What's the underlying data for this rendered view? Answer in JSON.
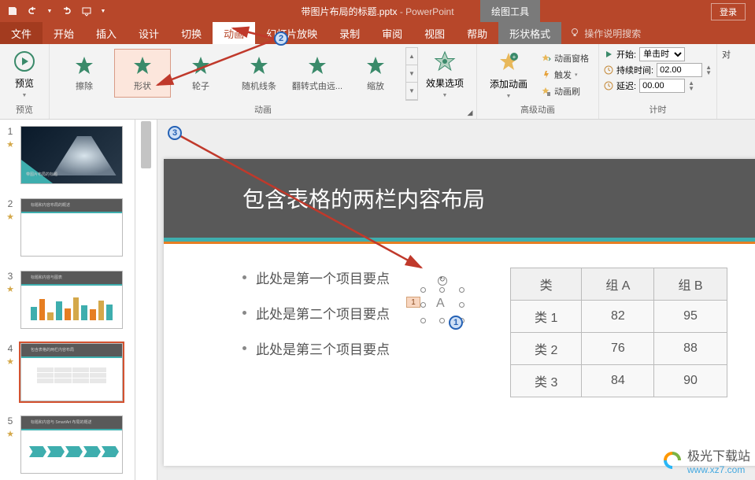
{
  "title": {
    "filename": "带图片布局的标题.pptx",
    "app": "PowerPoint",
    "context_tab": "绘图工具",
    "login": "登录"
  },
  "qat": {
    "save": "保存",
    "undo": "撤销",
    "redo": "重做",
    "start": "从头"
  },
  "tabs": {
    "file": "文件",
    "home": "开始",
    "insert": "插入",
    "design": "设计",
    "transitions": "切换",
    "animations": "动画",
    "slideshow": "幻灯片放映",
    "record": "录制",
    "review": "审阅",
    "view": "视图",
    "help": "帮助",
    "shape_format": "形状格式",
    "tell_me": "操作说明搜索"
  },
  "ribbon": {
    "preview_btn": "预览",
    "preview_group": "预览",
    "anims": {
      "wipe": "擦除",
      "shape": "形状",
      "wheel": "轮子",
      "random_bars": "随机线条",
      "flip": "翻转式由远...",
      "zoom": "缩放"
    },
    "anim_group": "动画",
    "effect_options": "效果选项",
    "add_animation": "添加动画",
    "adv_group": "高级动画",
    "anim_pane": "动画窗格",
    "trigger": "触发",
    "anim_painter": "动画刷",
    "timing_group": "计时",
    "start_label": "开始:",
    "duration_label": "持续时间:",
    "delay_label": "延迟:",
    "start_value": "单击时",
    "duration_value": "02.00",
    "delay_value": "00.00",
    "reorder": "对"
  },
  "slide": {
    "title": "包含表格的两栏内容布局",
    "bullets": [
      "此处是第一个项目要点",
      "此处是第二个项目要点",
      "此处是第三个项目要点"
    ],
    "table": {
      "headers": [
        "类",
        "组 A",
        "组 B"
      ],
      "rows": [
        [
          "类 1",
          "82",
          "95"
        ],
        [
          "类 2",
          "76",
          "88"
        ],
        [
          "类 3",
          "84",
          "90"
        ]
      ]
    },
    "inserted_tag": "1",
    "inserted_letter": "A"
  },
  "thumbs": {
    "count": 5,
    "active": 4
  },
  "watermark": {
    "brand": "极光下载站",
    "url": "www.xz7.com"
  },
  "markers": {
    "m1": "1",
    "m2": "2",
    "m3": "3"
  }
}
